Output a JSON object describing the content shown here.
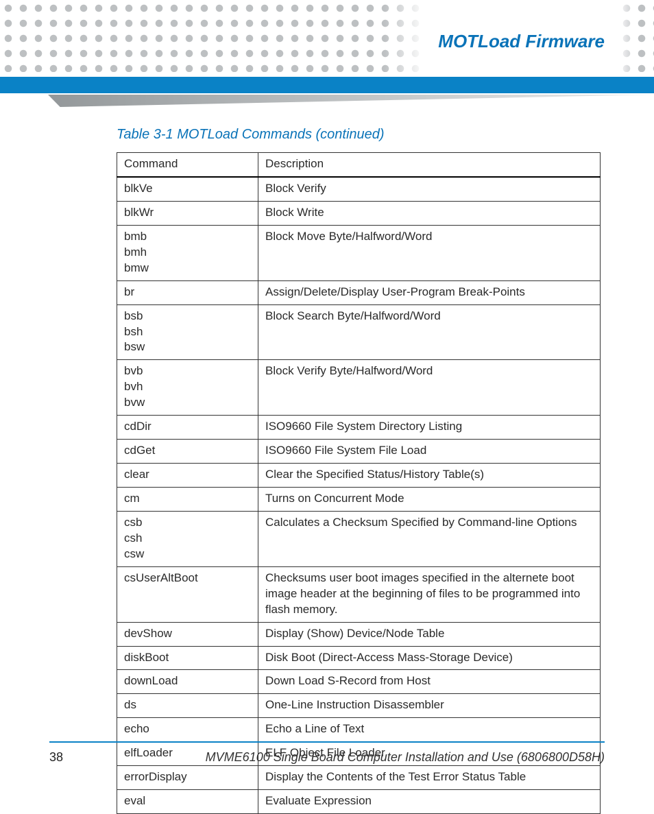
{
  "header": {
    "chapter_title": "MOTLoad Firmware"
  },
  "table": {
    "caption": "Table 3-1 MOTLoad Commands (continued)",
    "head": {
      "c1": "Command",
      "c2": "Description"
    },
    "rows": [
      {
        "cmd": [
          "blkVe"
        ],
        "desc": "Block Verify"
      },
      {
        "cmd": [
          "blkWr"
        ],
        "desc": "Block Write"
      },
      {
        "cmd": [
          "bmb",
          "bmh",
          "bmw"
        ],
        "desc": "Block Move Byte/Halfword/Word"
      },
      {
        "cmd": [
          "br"
        ],
        "desc": "Assign/Delete/Display User-Program Break-Points"
      },
      {
        "cmd": [
          "bsb",
          "bsh",
          "bsw"
        ],
        "desc": "Block Search Byte/Halfword/Word"
      },
      {
        "cmd": [
          "bvb",
          "bvh",
          "bvw"
        ],
        "desc": "Block Verify Byte/Halfword/Word"
      },
      {
        "cmd": [
          "cdDir"
        ],
        "desc": "ISO9660 File System Directory Listing"
      },
      {
        "cmd": [
          "cdGet"
        ],
        "desc": "ISO9660 File System File Load"
      },
      {
        "cmd": [
          "clear"
        ],
        "desc": "Clear the Specified Status/History Table(s)"
      },
      {
        "cmd": [
          "cm"
        ],
        "desc": "Turns on Concurrent Mode"
      },
      {
        "cmd": [
          "csb",
          "csh",
          "csw"
        ],
        "desc": "Calculates a Checksum Specified by Command-line Options"
      },
      {
        "cmd": [
          "csUserAltBoot"
        ],
        "desc": "Checksums user boot images specified in the alternete boot image header at the beginning of files to be programmed into flash memory."
      },
      {
        "cmd": [
          "devShow"
        ],
        "desc": "Display (Show) Device/Node Table"
      },
      {
        "cmd": [
          "diskBoot"
        ],
        "desc": "Disk Boot (Direct-Access Mass-Storage Device)"
      },
      {
        "cmd": [
          "downLoad"
        ],
        "desc": "Down Load S-Record from Host"
      },
      {
        "cmd": [
          "ds"
        ],
        "desc": "One-Line Instruction Disassembler"
      },
      {
        "cmd": [
          "echo"
        ],
        "desc": "Echo a Line of Text"
      },
      {
        "cmd": [
          "elfLoader"
        ],
        "desc": "ELF Object File Loader"
      },
      {
        "cmd": [
          "errorDisplay"
        ],
        "desc": "Display the Contents of the Test Error Status Table"
      },
      {
        "cmd": [
          "eval"
        ],
        "desc": "Evaluate Expression"
      }
    ]
  },
  "footer": {
    "page_number": "38",
    "doc_title": "MVME6100 Single Board Computer Installation and Use (6806800D58H)"
  }
}
